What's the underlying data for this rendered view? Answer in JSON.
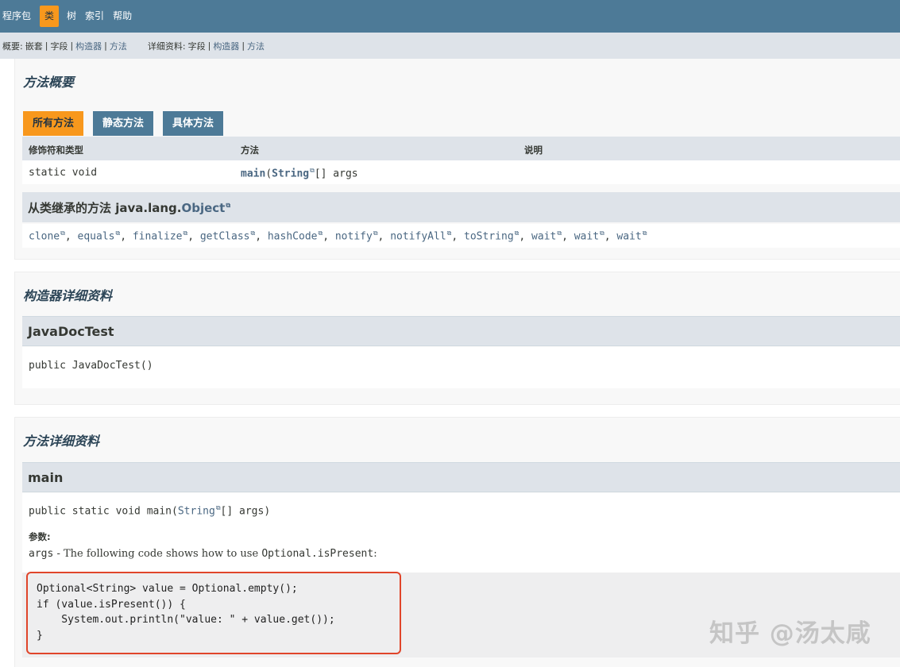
{
  "top_nav": {
    "items": [
      {
        "label": "程序包",
        "active": false
      },
      {
        "label": "类",
        "active": true
      },
      {
        "label": "树",
        "active": false
      },
      {
        "label": "索引",
        "active": false
      },
      {
        "label": "帮助",
        "active": false
      }
    ]
  },
  "sub_nav": {
    "summary_prefix": "概要:",
    "summary_nested": "嵌套",
    "summary_field": "字段",
    "summary_constructor": "构造器",
    "summary_method": "方法",
    "detail_prefix": "详细资料:",
    "detail_field": "字段",
    "detail_constructor": "构造器",
    "detail_method": "方法",
    "separator": "|"
  },
  "method_summary": {
    "title": "方法概要",
    "tabs": [
      "所有方法",
      "静态方法",
      "具体方法"
    ],
    "columns": [
      "修饰符和类型",
      "方法",
      "说明"
    ],
    "rows": [
      {
        "modifier": "static void",
        "method_name": "main",
        "param_type": "String",
        "param_rest": "[] args",
        "description": ""
      }
    ],
    "inherited_title_prefix": "从类继承的方法 java.lang.",
    "inherited_class": "Object",
    "inherited_methods": [
      "clone",
      "equals",
      "finalize",
      "getClass",
      "hashCode",
      "notify",
      "notifyAll",
      "toString",
      "wait",
      "wait",
      "wait"
    ]
  },
  "constructor_detail": {
    "title": "构造器详细资料",
    "name": "JavaDocTest",
    "signature": "public JavaDocTest()"
  },
  "method_detail": {
    "title": "方法详细资料",
    "name": "main",
    "signature_prefix": "public static void main(",
    "signature_type": "String",
    "signature_suffix": "[] args)",
    "params_label": "参数:",
    "param_name": "args",
    "param_desc": " - The following code shows how to use ",
    "param_code": "Optional.isPresent",
    "param_end": ":",
    "code": "Optional<String> value = Optional.empty();\nif (value.isPresent()) {\n    System.out.println(\"value: \" + value.get());\n}"
  },
  "watermark": "知乎 @汤太咸",
  "colors": {
    "nav_bg": "#4d7a97",
    "active_tab": "#f8981d",
    "header_bg": "#dee3e9",
    "link": "#4a6782",
    "highlight_border": "#e0452a"
  }
}
